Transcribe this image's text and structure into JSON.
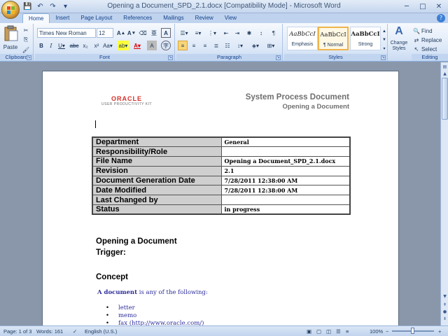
{
  "window": {
    "title": "Opening a Document_SPD_2.1.docx [Compatibility Mode] - Microsoft Word"
  },
  "tabs": [
    "Home",
    "Insert",
    "Page Layout",
    "References",
    "Mailings",
    "Review",
    "View"
  ],
  "ribbon": {
    "clipboard": {
      "label": "Clipboard",
      "paste": "Paste"
    },
    "font": {
      "label": "Font",
      "font_name": "Times New Roman",
      "font_size": "12"
    },
    "paragraph": {
      "label": "Paragraph"
    },
    "styles": {
      "label": "Styles",
      "items": [
        {
          "sample": "AaBbCcI",
          "name": "Emphasis"
        },
        {
          "sample": "AaBbCcI",
          "name": "¶ Normal"
        },
        {
          "sample": "AaBbCcI",
          "name": "Strong"
        }
      ],
      "change_styles": "Change Styles"
    },
    "editing": {
      "label": "Editing",
      "find": "Find",
      "replace": "Replace",
      "select": "Select"
    }
  },
  "document": {
    "logo_main": "ORACLE",
    "logo_sub": "USER PRODUCTIVITY KIT",
    "header_title": "System Process Document",
    "header_subtitle": "Opening a Document",
    "info_table": [
      {
        "key": "Department",
        "value": "General"
      },
      {
        "key": "Responsibility/Role",
        "value": ""
      },
      {
        "key": "File Name",
        "value": "Opening a Document_SPD_2.1.docx"
      },
      {
        "key": "Revision",
        "value": "2.1"
      },
      {
        "key": "Document Generation Date",
        "value": "7/28/2011 12:38:00 AM"
      },
      {
        "key": "Date Modified",
        "value": "7/28/2011 12:38:00 AM"
      },
      {
        "key": "Last Changed by",
        "value": ""
      },
      {
        "key": "Status",
        "value": "in progress"
      }
    ],
    "heading_open": "Opening a Document",
    "heading_trigger": "Trigger:",
    "heading_concept": "Concept",
    "para_bold": "A document",
    "para_rest": " is any of the following:",
    "bullets": [
      "letter",
      "memo",
      "fax (http://www.oracle.com/)"
    ]
  },
  "statusbar": {
    "page": "Page: 1 of 3",
    "words": "Words: 161",
    "language": "English (U.S.)",
    "zoom": "100%"
  }
}
